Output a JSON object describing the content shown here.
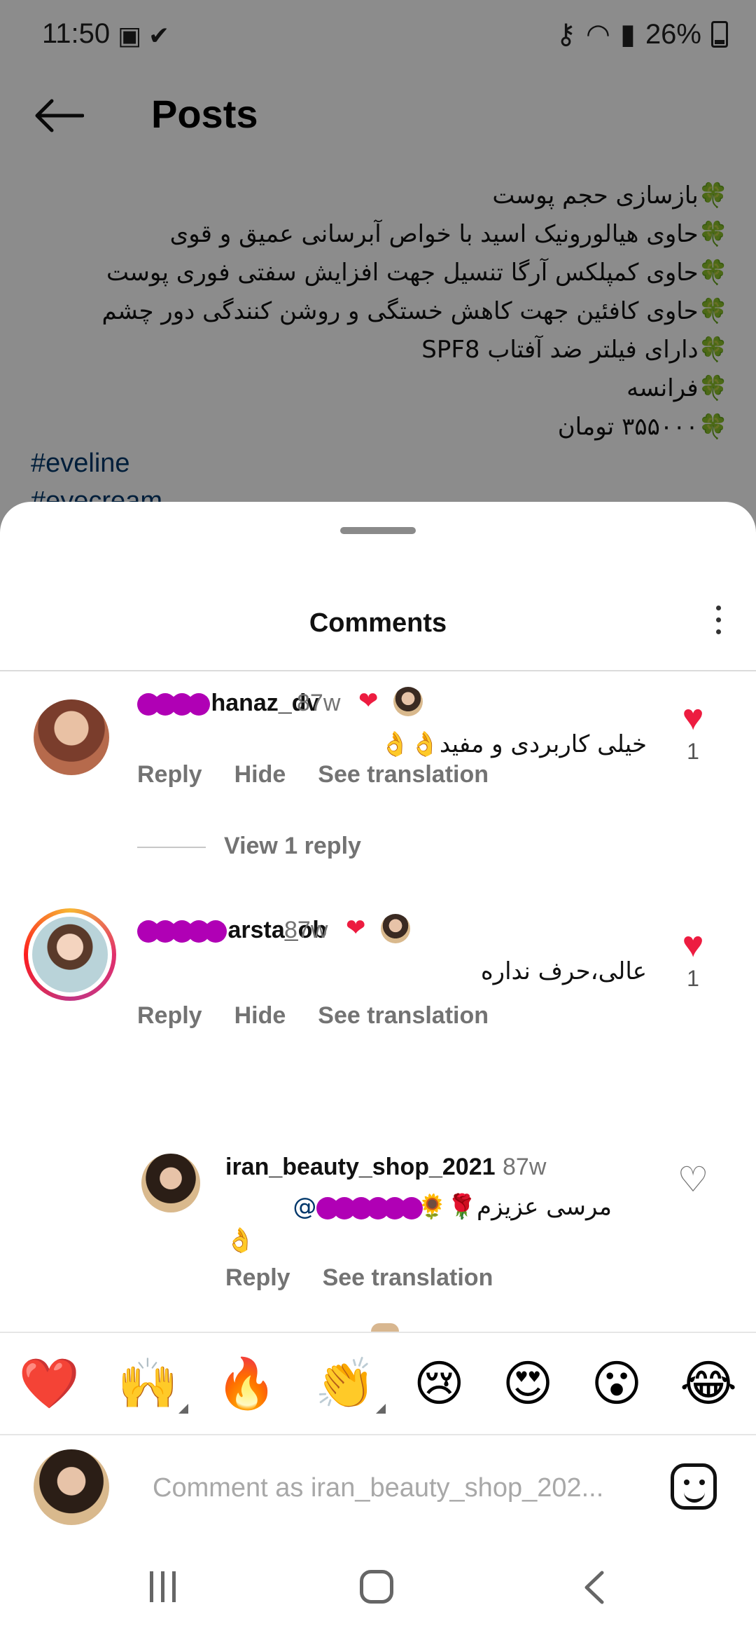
{
  "status_bar": {
    "time": "11:50",
    "battery": "26%"
  },
  "app_bar": {
    "title": "Posts"
  },
  "post": {
    "caption_lines": [
      "🍀بازسازی حجم پوست",
      "🍀حاوی هیالورونیک اسید با خواص آبرسانی عمیق و قوی",
      "🍀حاوی کمپلکس آرگا تنسیل جهت افزایش سفتی فوری پوست",
      "🍀حاوی کافئین جهت کاهش خستگی و روشن کنندگی دور چشم",
      "🍀دارای فیلتر ضد آفتاب SPF8",
      "🍀فرانسه",
      "🍀۳۵۵۰۰۰ تومان"
    ],
    "hashtag": "#eveline",
    "hashtag_partial": "#eyecream"
  },
  "sheet": {
    "title": "Comments"
  },
  "comments": [
    {
      "username_visible": "hanaz_dv",
      "time": "87w",
      "text": "خیلی کاربردی و مفید👌👌",
      "likes": "1",
      "actions": {
        "reply": "Reply",
        "hide": "Hide",
        "translate": "See translation"
      },
      "view_replies": "View 1 reply"
    },
    {
      "username_visible": "arsta_ob",
      "time": "87w",
      "text": "عالی،حرف نداره",
      "likes": "1",
      "actions": {
        "reply": "Reply",
        "hide": "Hide",
        "translate": "See translation"
      }
    }
  ],
  "reply": {
    "username": "iran_beauty_shop_2021",
    "time": "87w",
    "mention": "@",
    "text": "مرسی عزیزم🌹🌻",
    "text_line2": "👌",
    "actions": {
      "reply": "Reply",
      "translate": "See translation"
    }
  },
  "emoji_bar": [
    "❤️",
    "🙌",
    "🔥",
    "👏",
    "😢",
    "😍",
    "😮",
    "😂"
  ],
  "input": {
    "placeholder": "Comment as iran_beauty_shop_202..."
  },
  "colors": {
    "like_red": "#ed1c40",
    "link_blue": "#00376b",
    "muted": "#737373"
  }
}
